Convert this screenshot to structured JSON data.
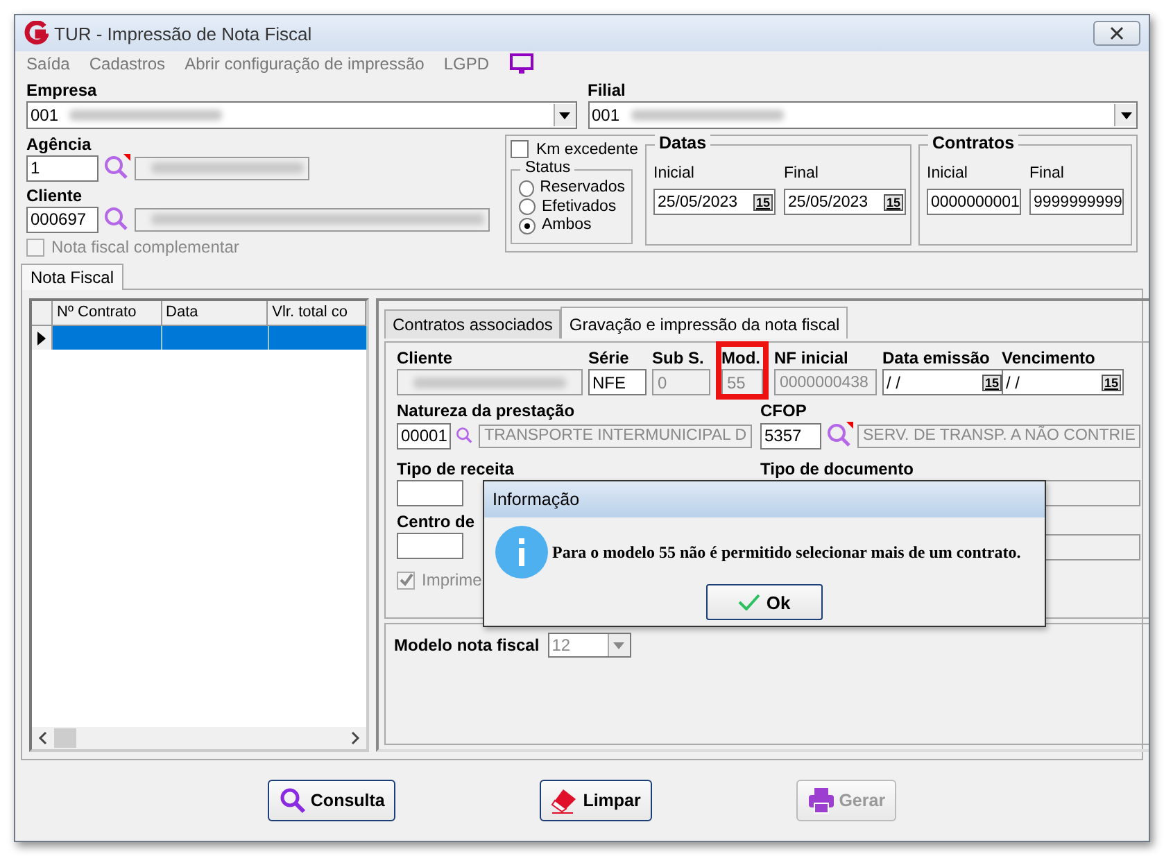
{
  "window": {
    "title": "TUR - Impressão de Nota Fiscal"
  },
  "menu": [
    {
      "label": "Saída"
    },
    {
      "label": "Cadastros"
    },
    {
      "label": "Abrir configuração de impressão"
    },
    {
      "label": "LGPD"
    }
  ],
  "empresa": {
    "label": "Empresa",
    "value": "001"
  },
  "filial": {
    "label": "Filial",
    "value": "001"
  },
  "agencia": {
    "label": "Agência",
    "value": "1"
  },
  "cliente": {
    "label": "Cliente",
    "value": "000697"
  },
  "nota_complementar": {
    "label": "Nota fiscal complementar",
    "checked": false,
    "disabled": true
  },
  "km_excedente": {
    "label": "Km excedente",
    "checked": false
  },
  "status": {
    "title": "Status",
    "options": [
      {
        "label": "Reservados",
        "selected": false
      },
      {
        "label": "Efetivados",
        "selected": false
      },
      {
        "label": "Ambos",
        "selected": true
      }
    ]
  },
  "datas": {
    "title": "Datas",
    "fields": [
      {
        "label": "Inicial",
        "value": "25/05/2023",
        "button": "15"
      },
      {
        "label": "Final",
        "value": "25/05/2023",
        "button": "15"
      }
    ]
  },
  "contratos": {
    "title": "Contratos",
    "fields": [
      {
        "label": "Inicial",
        "value": "0000000001"
      },
      {
        "label": "Final",
        "value": "9999999999"
      }
    ]
  },
  "main_tabs": [
    {
      "label": "Nota Fiscal",
      "selected": true
    }
  ],
  "grid": {
    "columns": [
      "Nº Contrato",
      "Data",
      "Vlr. total co"
    ],
    "rows": [
      {
        "selected": true
      }
    ]
  },
  "detail_tabs": [
    {
      "label": "Contratos associados",
      "selected": false
    },
    {
      "label": "Gravação e impressão da nota fiscal",
      "selected": true
    }
  ],
  "detail": {
    "cliente": {
      "label": "Cliente"
    },
    "serie": {
      "label": "Série",
      "value": "NFE"
    },
    "sub_serie": {
      "label": "Sub S.",
      "value": "0"
    },
    "modelo": {
      "label": "Mod.",
      "value": "55",
      "highlighted": true
    },
    "nf_inicial": {
      "label": "NF inicial",
      "value": "0000000438"
    },
    "data_emissao": {
      "label": "Data emissão",
      "value": "/ /",
      "button": "15"
    },
    "vencimento": {
      "label": "Vencimento",
      "value": "/ /",
      "button": "15"
    },
    "natureza": {
      "label": "Natureza da prestação",
      "code": "00001",
      "description": "TRANSPORTE INTERMUNICIPAL D"
    },
    "cfop": {
      "label": "CFOP",
      "code": "5357",
      "description": "SERV. DE TRANSP.  A NÃO CONTRIE"
    },
    "tipo_receita": {
      "label": "Tipo de receita"
    },
    "tipo_documento": {
      "label": "Tipo de documento"
    },
    "centro": {
      "label": "Centro de"
    },
    "imprime": {
      "label": "Imprime",
      "checked": true,
      "disabled": true
    },
    "modelo_nota": {
      "label": "Modelo nota fiscal",
      "value": "12"
    }
  },
  "dialog": {
    "title": "Informação",
    "message": "Para o modelo 55 não é permitido selecionar mais de um contrato.",
    "button": "Ok"
  },
  "buttons": [
    {
      "label": "Consulta",
      "kind": "search",
      "disabled": false
    },
    {
      "label": "Limpar",
      "kind": "eraser",
      "disabled": false
    },
    {
      "label": "Gerar",
      "kind": "print",
      "disabled": true
    }
  ]
}
